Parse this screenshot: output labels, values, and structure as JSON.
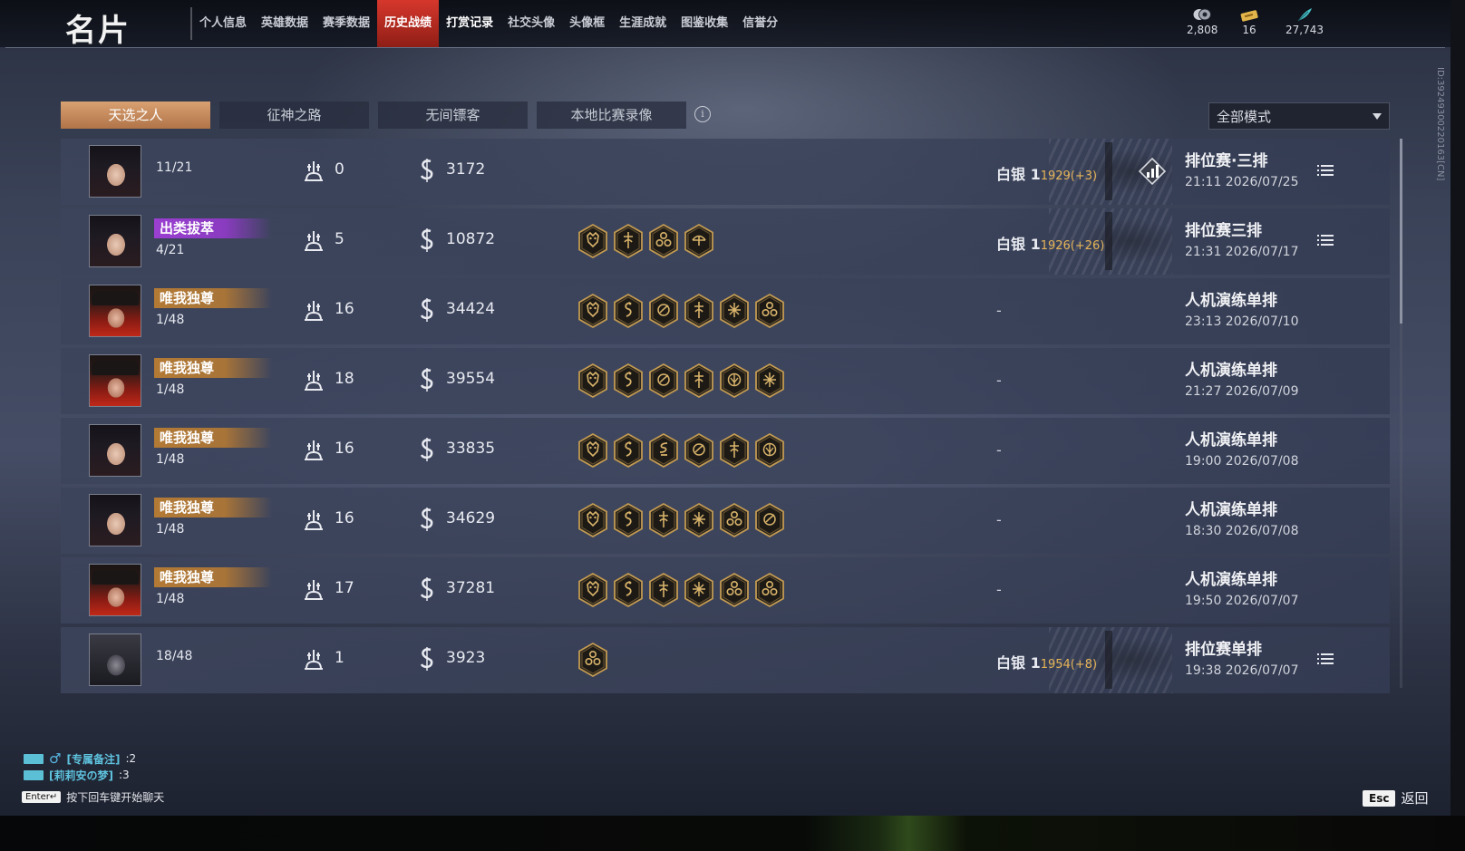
{
  "header": {
    "title": "名片",
    "nav": [
      "个人信息",
      "英雄数据",
      "赛季数据",
      "历史战绩",
      "打赏记录",
      "社交头像",
      "头像框",
      "生涯成就",
      "图鉴收集",
      "信誉分"
    ],
    "active_nav": "历史战绩",
    "currencies": [
      {
        "icon": "coins-icon",
        "value": "2,808"
      },
      {
        "icon": "ticket-icon",
        "value": "16"
      },
      {
        "icon": "feather-icon",
        "value": "27,743"
      }
    ]
  },
  "side_id": "ID:392493002201​63[CN]",
  "tabs": [
    "天选之人",
    "征神之路",
    "无间镖客",
    "本地比赛录像"
  ],
  "active_tab": "天选之人",
  "mode_filter": "全部模式",
  "matches": [
    {
      "avatar": "a",
      "badge": "",
      "placement": "11/21",
      "kills": "0",
      "damage": "3172",
      "items": [],
      "tier": "白银 1",
      "delta": "1929(+3)",
      "mode": "排位赛·三排",
      "time": "21:11  2026/07/25",
      "has_details": true,
      "has_stats": true
    },
    {
      "avatar": "a",
      "badge": "出类拔萃",
      "badge_color": "purple",
      "placement": "4/21",
      "kills": "5",
      "damage": "10872",
      "items": [
        "demon-mask-icon",
        "sword-icon",
        "flame-cluster-icon",
        "bow-icon"
      ],
      "tier": "白银 1",
      "delta": "1926(+26)",
      "mode": "排位赛三排",
      "time": "21:31  2026/07/17",
      "has_details": true,
      "has_stats": false
    },
    {
      "avatar": "b",
      "badge": "唯我独尊",
      "badge_color": "gold",
      "placement": "1/48",
      "kills": "16",
      "damage": "34424",
      "items": [
        "demon-mask-icon",
        "dragon-icon",
        "phoenix-icon",
        "sword-icon",
        "star-burst-icon",
        "flame-cluster-icon"
      ],
      "tier": "-",
      "delta": "",
      "mode": "人机演练单排",
      "time": "23:13  2026/07/10",
      "has_details": false,
      "has_stats": false
    },
    {
      "avatar": "b",
      "badge": "唯我独尊",
      "badge_color": "gold",
      "placement": "1/48",
      "kills": "18",
      "damage": "39554",
      "items": [
        "demon-mask-icon",
        "dragon-icon",
        "phoenix-icon",
        "sword-icon",
        "lotus-icon",
        "star-burst-icon"
      ],
      "tier": "-",
      "delta": "",
      "mode": "人机演练单排",
      "time": "21:27  2026/07/09",
      "has_details": false,
      "has_stats": false
    },
    {
      "avatar": "a",
      "badge": "唯我独尊",
      "badge_color": "gold",
      "placement": "1/48",
      "kills": "16",
      "damage": "33835",
      "items": [
        "demon-mask-icon",
        "dragon-icon",
        "serpent-icon",
        "phoenix-icon",
        "sword-icon",
        "lotus-icon"
      ],
      "tier": "-",
      "delta": "",
      "mode": "人机演练单排",
      "time": "19:00  2026/07/08",
      "has_details": false,
      "has_stats": false
    },
    {
      "avatar": "a",
      "badge": "唯我独尊",
      "badge_color": "gold",
      "placement": "1/48",
      "kills": "16",
      "damage": "34629",
      "items": [
        "demon-mask-icon",
        "dragon-icon",
        "sword-icon",
        "star-burst-icon",
        "flame-cluster-icon",
        "phoenix-icon"
      ],
      "tier": "-",
      "delta": "",
      "mode": "人机演练单排",
      "time": "18:30  2026/07/08",
      "has_details": false,
      "has_stats": false
    },
    {
      "avatar": "b",
      "badge": "唯我独尊",
      "badge_color": "gold",
      "placement": "1/48",
      "kills": "17",
      "damage": "37281",
      "items": [
        "demon-mask-icon",
        "dragon-icon",
        "sword-icon",
        "star-burst-icon",
        "flame-cluster-icon",
        "flame-cluster-icon"
      ],
      "tier": "-",
      "delta": "",
      "mode": "人机演练单排",
      "time": "19:50  2026/07/07",
      "has_details": false,
      "has_stats": false
    },
    {
      "avatar": "c",
      "badge": "",
      "placement": "18/48",
      "kills": "1",
      "damage": "3923",
      "items": [
        "flame-cluster-icon"
      ],
      "tier": "白银 1",
      "delta": "1954(+8)",
      "mode": "排位赛单排",
      "time": "19:38  2026/07/07",
      "has_details": true,
      "has_stats": false
    }
  ],
  "chat": [
    {
      "name": "[专属备注]",
      "value": ":2",
      "male": true
    },
    {
      "name": "[莉莉安の梦]",
      "value": ":3",
      "male": false
    }
  ],
  "enter_key": "Enter↵",
  "enter_hint": "按下回车键开始聊天",
  "esc_key": "Esc",
  "esc_label": "返回",
  "colors": {
    "accent_red": "#d6372c",
    "tab_active": "#d9a071",
    "badge_purple": "#9a3fd1",
    "badge_gold": "#b37a35",
    "delta_gold": "#e5b458",
    "chat_cyan": "#5fc3df"
  }
}
